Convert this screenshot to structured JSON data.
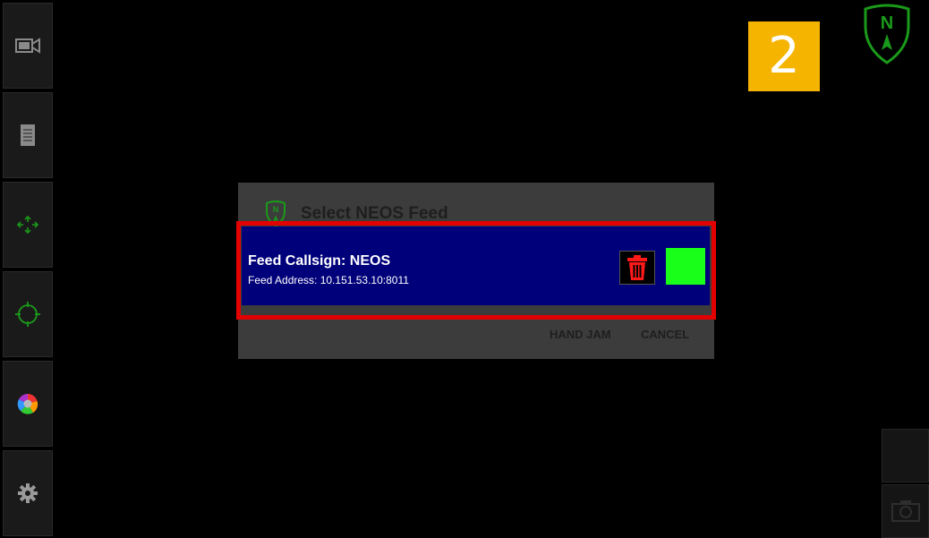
{
  "step_number": "2",
  "sidebar": {
    "items": [
      {
        "icon": "video-camera-icon"
      },
      {
        "icon": "document-icon"
      },
      {
        "icon": "move-arrows-icon"
      },
      {
        "icon": "crosshair-icon"
      },
      {
        "icon": "color-wheel-icon"
      },
      {
        "icon": "gear-icon"
      }
    ]
  },
  "dialog": {
    "title": "Select NEOS Feed",
    "feed": {
      "callsign": "Feed Callsign: NEOS",
      "address": "Feed Address: 10.151.53.10:8011",
      "status_color": "#19ff19"
    },
    "buttons": {
      "hand_jam": "HAND JAM",
      "cancel": "CANCEL"
    }
  },
  "colors": {
    "highlight": "#e30000",
    "feed_row_bg": "#00007a",
    "badge": "#f4b400",
    "neos_green": "#1a9a1a"
  },
  "right_controls": [
    {
      "icon": "blank-button"
    },
    {
      "icon": "camera-icon"
    }
  ]
}
